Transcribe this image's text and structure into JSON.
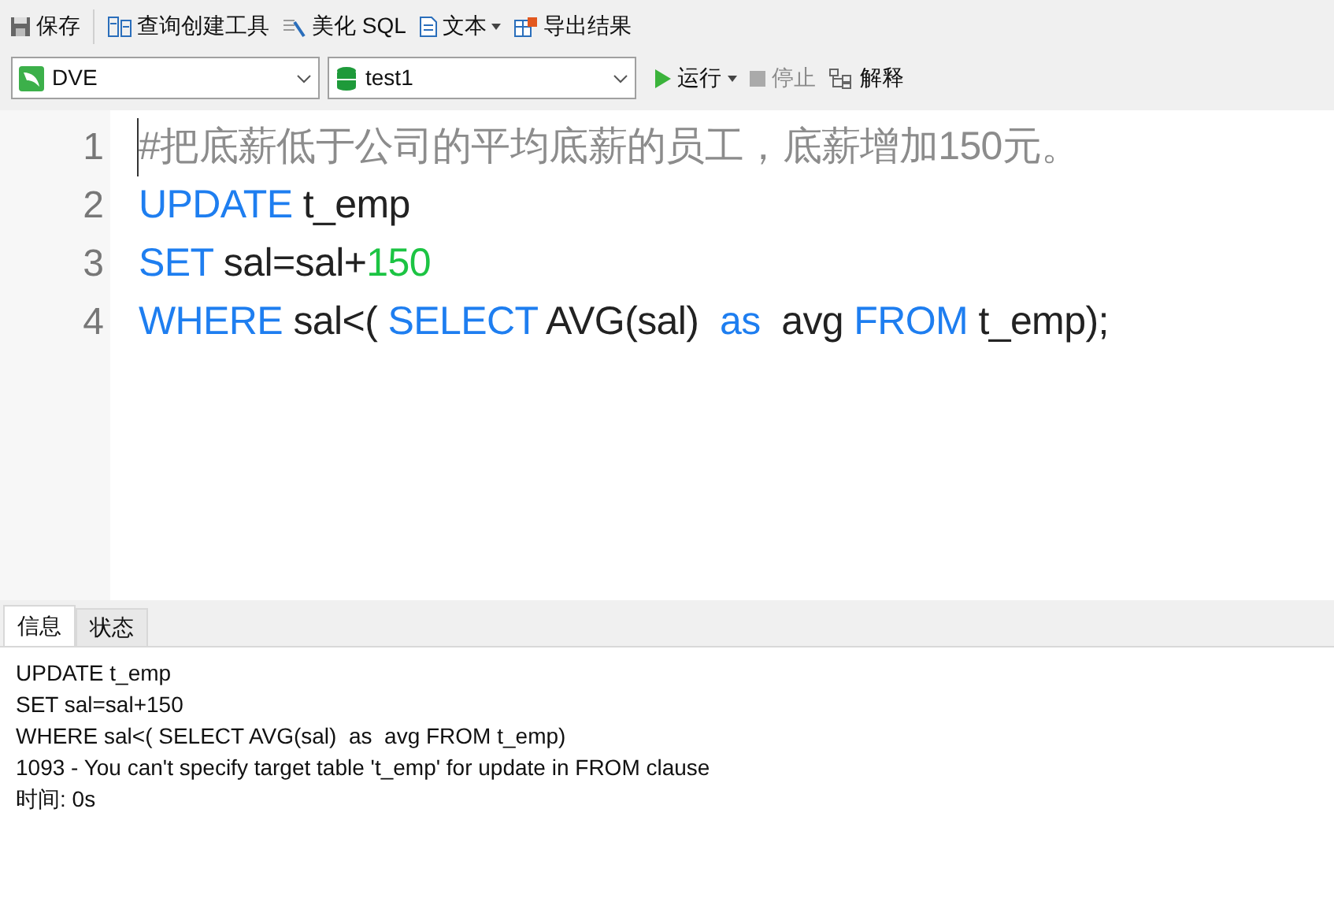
{
  "toolbar": [
    {
      "kind": "save",
      "label": "保存"
    },
    {
      "kind": "query",
      "label": "查询创建工具"
    },
    {
      "kind": "beautify",
      "label": "美化 SQL"
    },
    {
      "kind": "text",
      "label": "文本",
      "dropdown": true
    },
    {
      "kind": "export",
      "label": "导出结果"
    }
  ],
  "connection": {
    "value": "DVE"
  },
  "database": {
    "value": "test1"
  },
  "actions": [
    {
      "kind": "run",
      "label": "运行",
      "dropdown": true,
      "disabled": false
    },
    {
      "kind": "stop",
      "label": "停止",
      "disabled": true
    },
    {
      "kind": "explain",
      "label": "解释",
      "disabled": false
    }
  ],
  "editor": {
    "lines": [
      {
        "number": "1",
        "tokens": [
          {
            "kind": "comment",
            "text": "#把底薪低于公司的平均底薪的员工，底薪增加150元。"
          }
        ]
      },
      {
        "number": "2",
        "tokens": [
          {
            "kind": "keyword",
            "text": "UPDATE"
          },
          {
            "kind": "plain",
            "text": " t_emp"
          }
        ]
      },
      {
        "number": "3",
        "tokens": [
          {
            "kind": "keyword",
            "text": "SET"
          },
          {
            "kind": "plain",
            "text": " sal=sal+"
          },
          {
            "kind": "number",
            "text": "150"
          }
        ]
      },
      {
        "number": "4",
        "tokens": [
          {
            "kind": "keyword",
            "text": "WHERE"
          },
          {
            "kind": "plain",
            "text": " sal<( "
          },
          {
            "kind": "keyword",
            "text": "SELECT"
          },
          {
            "kind": "plain",
            "text": " AVG(sal)  "
          },
          {
            "kind": "keyword",
            "text": "as"
          },
          {
            "kind": "plain",
            "text": "  avg "
          },
          {
            "kind": "keyword",
            "text": "FROM"
          },
          {
            "kind": "plain",
            "text": " t_emp);"
          }
        ]
      }
    ]
  },
  "tabs": [
    {
      "label": "信息",
      "selected": true
    },
    {
      "label": "状态",
      "selected": false
    }
  ],
  "messages": [
    "UPDATE t_emp",
    "SET sal=sal+150",
    "WHERE sal<( SELECT AVG(sal)  as  avg FROM t_emp)",
    "1093 - You can't specify target table 't_emp' for update in FROM clause",
    "时间: 0s"
  ]
}
